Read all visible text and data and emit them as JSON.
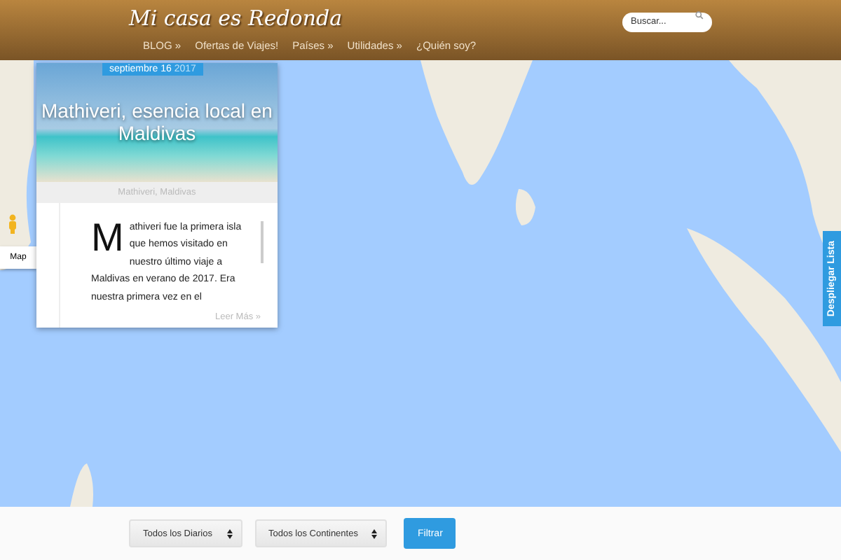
{
  "header": {
    "logo": "Mi casa es Redonda",
    "search": {
      "placeholder": "Buscar..."
    },
    "nav": [
      {
        "label": "BLOG »"
      },
      {
        "label": "Ofertas de Viajes!"
      },
      {
        "label": "Países »"
      },
      {
        "label": "Utilidades »"
      },
      {
        "label": "¿Quién soy?"
      }
    ]
  },
  "map": {
    "map_type_button": "Map",
    "side_tab": "Despliegar Lista"
  },
  "post": {
    "date": "septiembre 16",
    "year": "2017",
    "title": "Mathiveri, esencia local en Maldivas",
    "location": "Mathiveri, Maldivas",
    "excerpt": "Mathiveri fue la primera isla que hemos visitado en nuestro último viaje a Maldivas en verano de 2017. Era nuestra primera vez en el",
    "read_more": "Leer Más »"
  },
  "filters": {
    "selects": [
      {
        "label": "Todos los Diarios"
      },
      {
        "label": "Todos los Continentes"
      }
    ],
    "button": "Filtrar"
  }
}
